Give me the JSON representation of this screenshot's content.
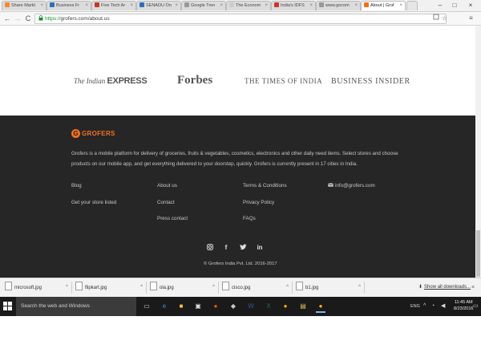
{
  "browser": {
    "tabs": [
      {
        "label": "Share Markt",
        "color": "#f28c28",
        "active": false
      },
      {
        "label": "Business Fr",
        "color": "#2e6fb7",
        "active": false
      },
      {
        "label": "Five Tech Ar",
        "color": "#c0392b",
        "active": false
      },
      {
        "label": "SENADU On",
        "color": "#2e6fb7",
        "active": false
      },
      {
        "label": "Google Tren",
        "color": "#999999",
        "active": false
      },
      {
        "label": "The Econom",
        "color": "#cccccc",
        "active": false
      },
      {
        "label": "India's IDFS",
        "color": "#cc3333",
        "active": false
      },
      {
        "label": "www.gocom",
        "color": "#999999",
        "active": false
      },
      {
        "label": "About | Grof",
        "color": "#f37021",
        "active": true
      }
    ],
    "tab_close_glyph": "×",
    "window_controls": {
      "minimize": "–",
      "maximize": "□",
      "close": "×"
    },
    "nav": {
      "back": "←",
      "forward": "→",
      "reload": "C"
    },
    "address": {
      "scheme": "https://",
      "host_path": "grofers.com/about.us"
    },
    "toolbar_icons": [
      "extension-icon",
      "star-icon",
      "menu-icon"
    ]
  },
  "press": {
    "indian_express_prefix": "The Indian",
    "indian_express_bold": "EXPRESS",
    "forbes": "Forbes",
    "toi": "THE TIMES OF INDIA",
    "bi": "BUSINESS INSIDER"
  },
  "footer": {
    "brand_mark": "G",
    "brand_name": "GROFERS",
    "about": "Grofers is a mobile platform for delivery of groceries, fruits & vegetables, cosmetics, electronics and other daily need items. Select stores and choose products on our mobile app, and get everything delivered to your doorstep, quickly. Grofers is currently present in 17 cities in India.",
    "links": {
      "blog": "Blog",
      "store": "Get your store listed",
      "about": "About us",
      "contact": "Contact",
      "press": "Press contact",
      "terms": "Terms & Conditions",
      "privacy": "Privacy Policy",
      "faqs": "FAQs",
      "email": "info@grofers.com"
    },
    "social_icons": [
      "instagram-icon",
      "facebook-icon",
      "twitter-icon",
      "linkedin-icon"
    ],
    "copyright": "© Grofers India Pvt. Ltd. 2016-2017"
  },
  "downloads": {
    "items": [
      "microsoft.jpg",
      "flipkart.jpg",
      "ola.jpg",
      "cisco.jpg",
      "b1.jpg"
    ],
    "show_all": "Show all downloads...",
    "close": "×"
  },
  "taskbar": {
    "search_placeholder": "Search the web and Windows",
    "lang": "ENG",
    "time": "11:45 AM",
    "date": "8/23/2016",
    "accent": "#7fb2f0"
  }
}
